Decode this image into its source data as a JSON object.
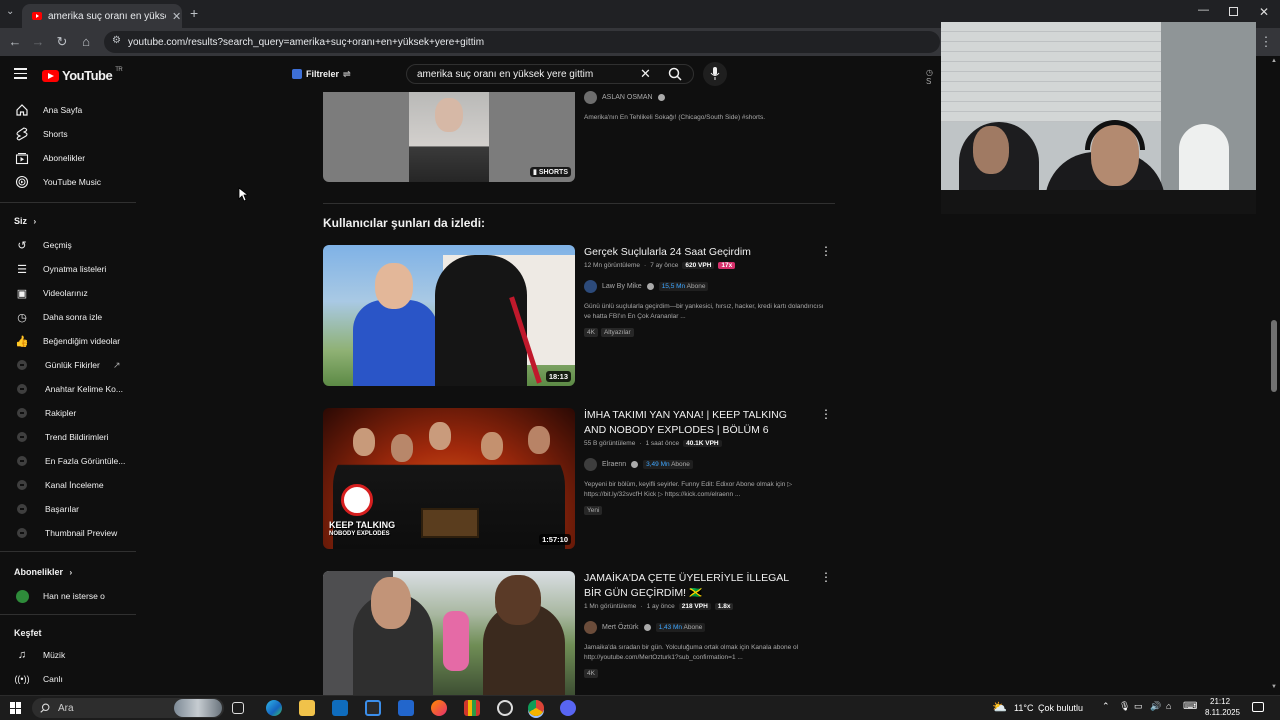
{
  "browser": {
    "tab_title": "amerika suç oranı en yüksek ye",
    "url": "youtube.com/results?search_query=amerika+suç+oranı+en+yüksek+yere+gittim"
  },
  "header": {
    "logo_text": "YouTube",
    "logo_region": "TR",
    "filters_label": "Filtreler",
    "search_value": "amerika suç oranı en yüksek yere gittim",
    "right_fragment": "S"
  },
  "sidebar": {
    "main": [
      {
        "label": "Ana Sayfa",
        "icon": "home-icon"
      },
      {
        "label": "Shorts",
        "icon": "shorts-icon"
      },
      {
        "label": "Abonelikler",
        "icon": "subscriptions-icon"
      },
      {
        "label": "YouTube Music",
        "icon": "music-icon"
      }
    ],
    "you_title": "Siz",
    "you": [
      {
        "label": "Geçmiş",
        "icon": "history-icon"
      },
      {
        "label": "Oynatma listeleri",
        "icon": "playlist-icon"
      },
      {
        "label": "Videolarınız",
        "icon": "video-icon"
      },
      {
        "label": "Daha sonra izle",
        "icon": "clock-icon"
      },
      {
        "label": "Beğendiğim videolar",
        "icon": "thumbs-up-icon"
      },
      {
        "label": "Günlük Fikirler",
        "icon": "extension-icon"
      },
      {
        "label": "Anahtar Kelime Ko...",
        "icon": "extension-icon"
      },
      {
        "label": "Rakipler",
        "icon": "extension-icon"
      },
      {
        "label": "Trend Bildirimleri",
        "icon": "extension-icon"
      },
      {
        "label": "En Fazla Görüntüle...",
        "icon": "extension-icon"
      },
      {
        "label": "Kanal İnceleme",
        "icon": "extension-icon"
      },
      {
        "label": "Başarılar",
        "icon": "extension-icon"
      },
      {
        "label": "Thumbnail Preview",
        "icon": "extension-icon"
      }
    ],
    "subs_title": "Abonelikler",
    "subs": [
      {
        "label": "Han ne isterse o"
      }
    ],
    "explore_title": "Keşfet",
    "explore": [
      {
        "label": "Müzik",
        "icon": "music-note-icon"
      },
      {
        "label": "Canlı",
        "icon": "live-icon"
      }
    ]
  },
  "top_result": {
    "channel": "ASLAN OSMAN",
    "desc": "Amerika'nın En Tehlikeli Sokağı! (Chicago/South Side) #shorts.",
    "badge": "SHORTS"
  },
  "section_heading": "Kullanıcılar şunları da izledi:",
  "videos": [
    {
      "title": "Gerçek Suçlularla 24 Saat Geçirdim",
      "views": "12 Mn görüntüleme",
      "age": "7 ay önce",
      "vph": "620 VPH",
      "multiplier": "17x",
      "channel": "Law By Mike",
      "subs_num": "15,5 Mn",
      "subs_word": "Abone",
      "desc": "Günü ünlü suçlularla geçirdim—bir yankesici, hırsız, hacker, kredi kartı dolandırıcısı ve hatta FBI'ın En Çok Arananlar ...",
      "tags": [
        "4K",
        "Altyazılar"
      ],
      "duration": "18:13"
    },
    {
      "title": "İMHA TAKIMI YAN YANA! | KEEP TALKING AND NOBODY EXPLODES | BÖLÜM 6",
      "views": "55 B görüntüleme",
      "age": "1 saat önce",
      "vph": "40.1K VPH",
      "channel": "Elraenn",
      "subs_num": "3,49 Mn",
      "subs_word": "Abone",
      "desc": "Yepyeni bir bölüm, keyifli seyirler. Funny Edit: Edixor Abone olmak için ▷ https://bit.ly/32svcfH Kick ▷ https://kick.com/elraenn ...",
      "tags": [
        "Yeni"
      ],
      "duration": "1:57:10",
      "thumb_text_1": "KEEP TALKING",
      "thumb_text_2": "NOBODY EXPLODES"
    },
    {
      "title": "JAMAİKA'DA ÇETE ÜYELERİYLE İLLEGAL BİR GÜN GEÇİRDİM! 🇯🇲",
      "views": "1 Mn görüntüleme",
      "age": "1 ay önce",
      "vph": "218 VPH",
      "multiplier": "1.8x",
      "channel": "Mert Öztürk",
      "subs_num": "1,43 Mn",
      "subs_word": "Abone",
      "desc": "Jamaika'da sıradan bir gün. Yolculuğuma ortak olmak için Kanala abone ol http://youtube.com/MertOzturk1?sub_confirmation=1 ...",
      "tags": [
        "4K"
      ]
    }
  ],
  "taskbar": {
    "search_text": "Ara",
    "weather": "11°C",
    "weather_desc": "Çok bulutlu",
    "time": "21:12",
    "date": "8.11.2025"
  },
  "colors": {
    "background": "#0f0f0f",
    "accent_red": "#ff0000",
    "link_blue": "#3ea6ff",
    "multiplier_pink": "#d6306b"
  }
}
